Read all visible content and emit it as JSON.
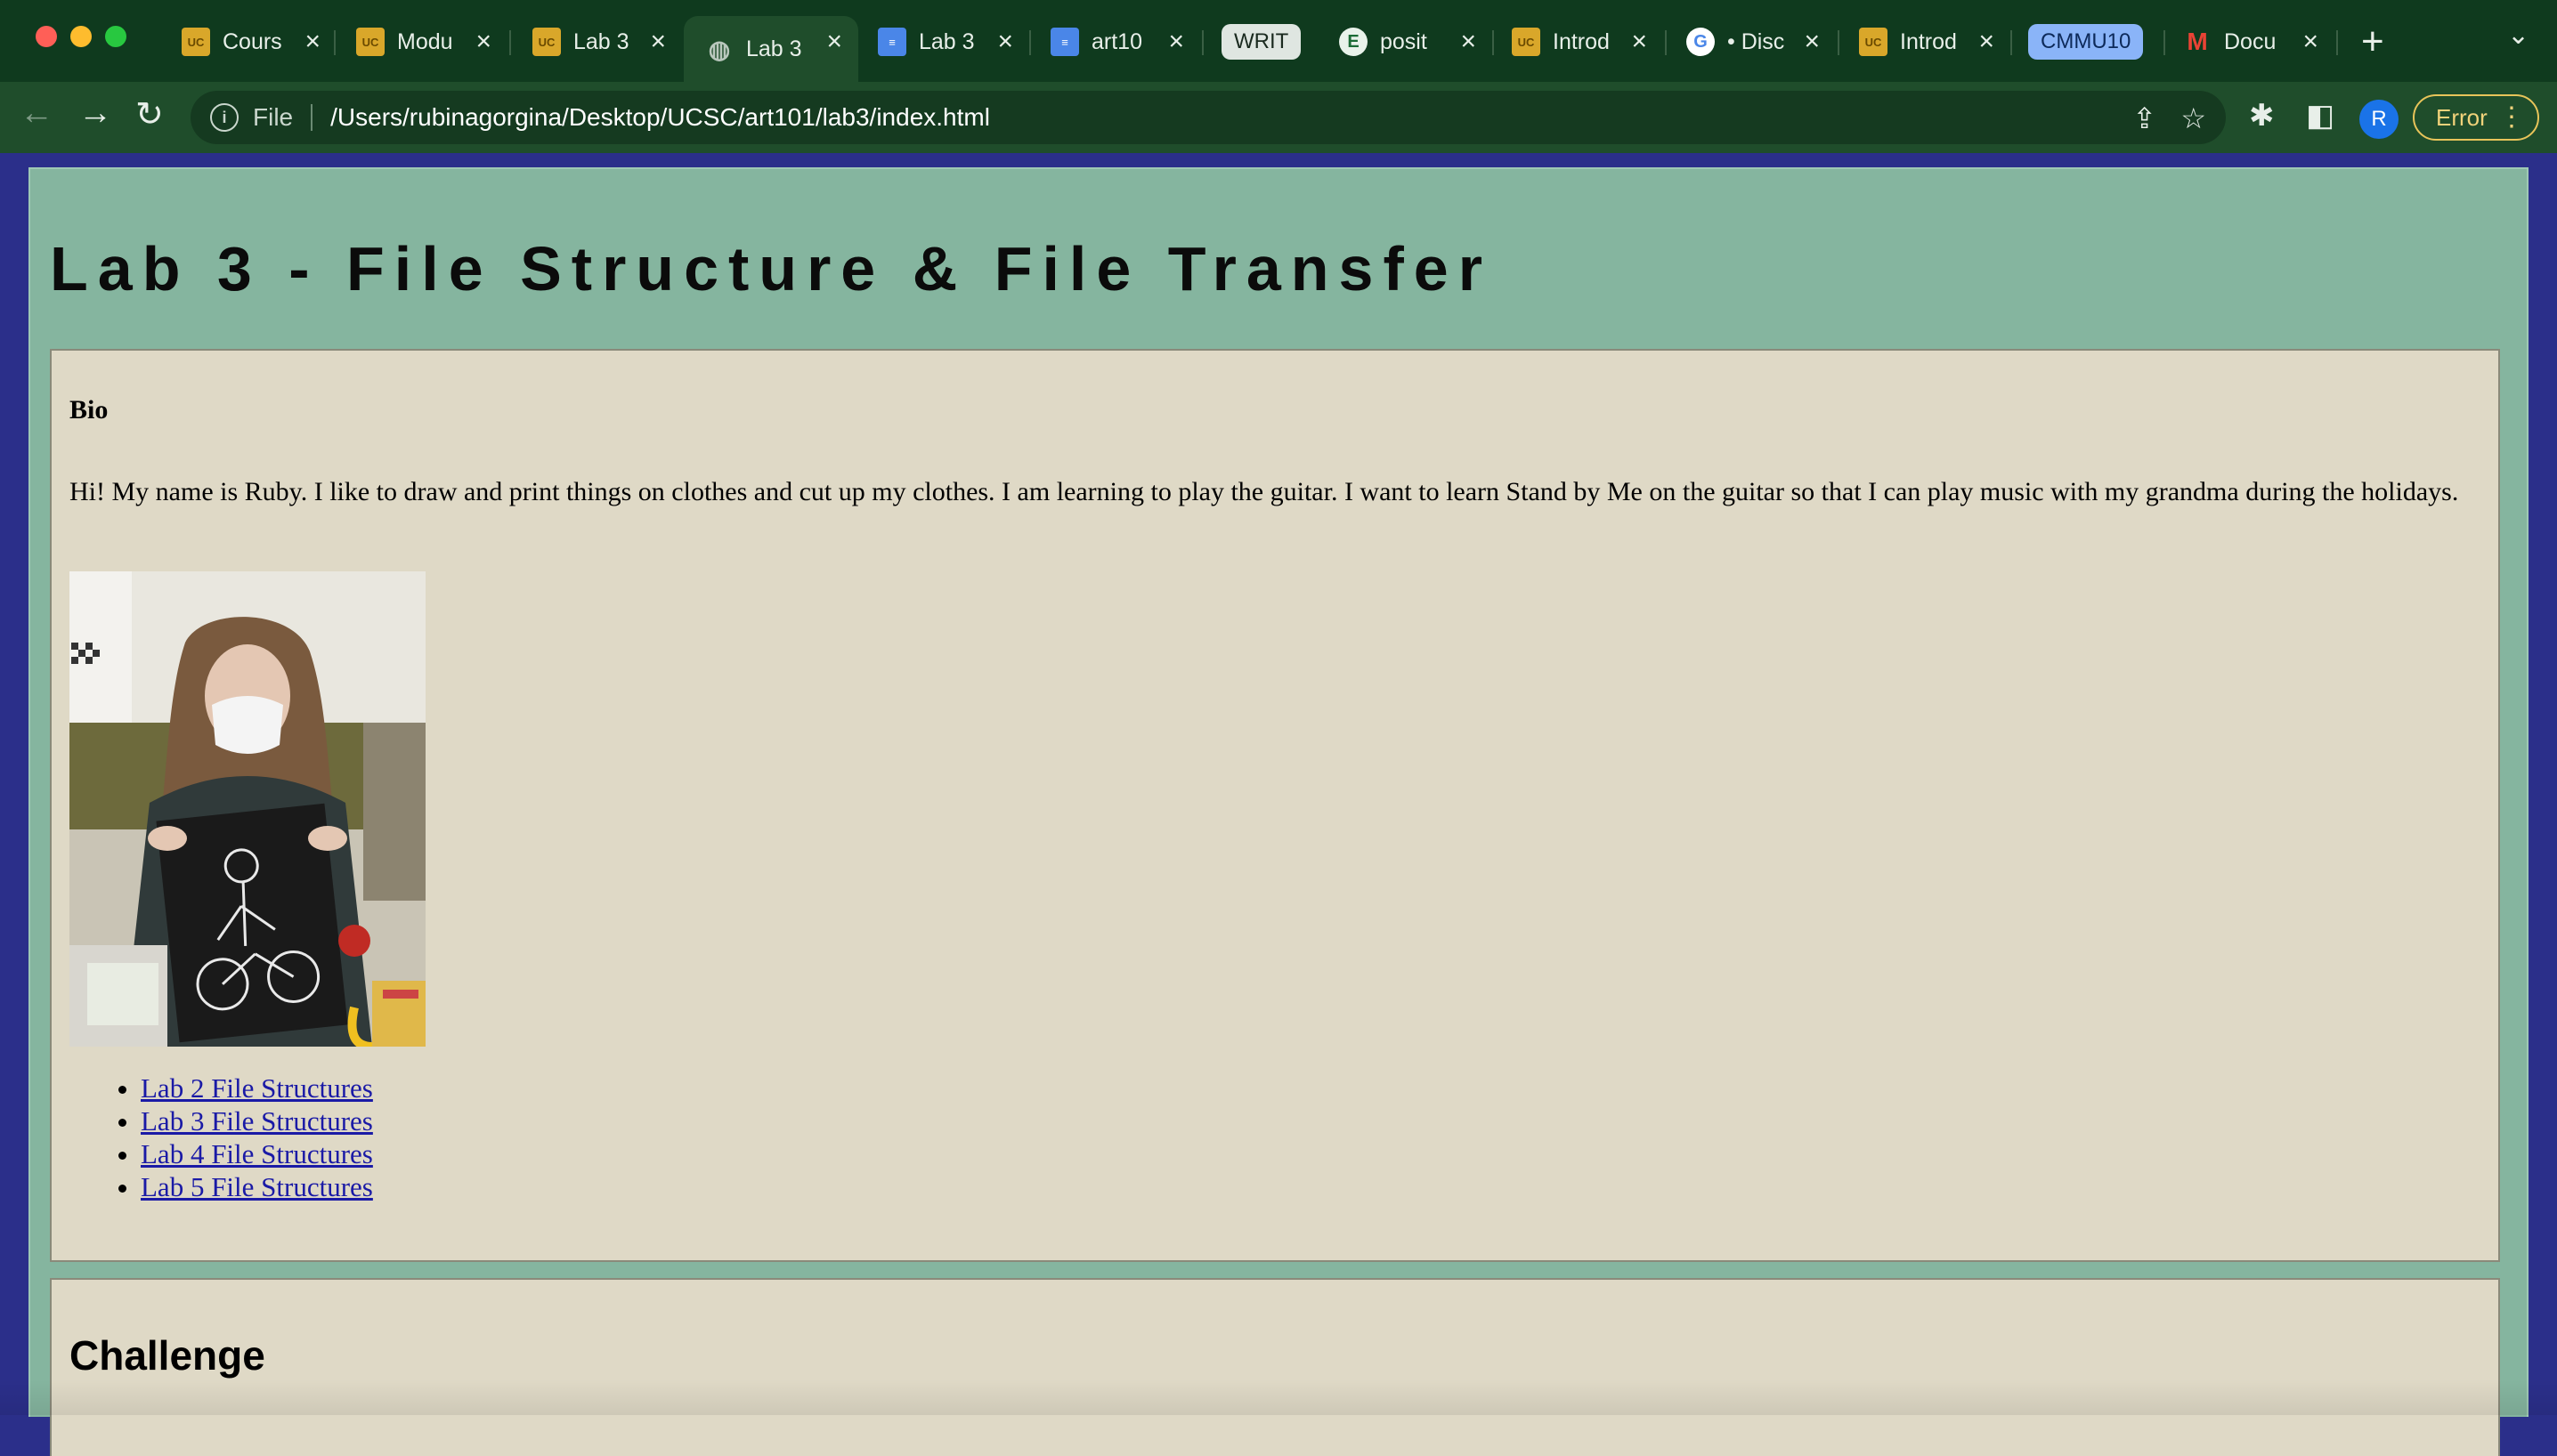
{
  "browser": {
    "tabs": [
      {
        "title": "Cours",
        "favicon": "ucsc-icon",
        "active": false
      },
      {
        "title": "Modu",
        "favicon": "ucsc-icon",
        "active": false
      },
      {
        "title": "Lab 3",
        "favicon": "ucsc-icon",
        "active": false
      },
      {
        "title": "Lab 3",
        "favicon": "globe-icon",
        "active": true
      },
      {
        "title": "Lab 3",
        "favicon": "docs-icon",
        "active": false
      },
      {
        "title": "art10",
        "favicon": "docs-icon",
        "active": false
      },
      {
        "title": "WRIT",
        "favicon": "none",
        "active": false
      },
      {
        "title": "posit",
        "favicon": "e-icon",
        "active": false
      },
      {
        "title": "Introd",
        "favicon": "ucsc-icon",
        "active": false
      },
      {
        "title": "• Disc",
        "favicon": "google-icon",
        "active": false
      },
      {
        "title": "Introd",
        "favicon": "ucsc-icon",
        "active": false
      },
      {
        "title": "CMMU10",
        "favicon": "none",
        "active": false
      },
      {
        "title": "Docu",
        "favicon": "gmail-icon",
        "active": false
      }
    ],
    "address": {
      "scheme_label": "File",
      "url": "/Users/rubinagorgina/Desktop/UCSC/art101/lab3/index.html"
    },
    "profile_initial": "R",
    "error_label": "Error",
    "colors": {
      "tabstrip": "#0f3a1e",
      "toolbar": "#1f4d2b",
      "error_accent": "#e8c45a"
    }
  },
  "page": {
    "title": "Lab 3 - File Structure & File Transfer",
    "bio": {
      "heading": "Bio",
      "text": "Hi! My name is Ruby. I like to draw and print things on clothes and cut up my clothes. I am learning to play the guitar. I want to learn Stand by Me on the guitar so that I can play music with my grandma during the holidays.",
      "links": [
        "Lab 2 File Structures",
        "Lab 3 File Structures",
        "Lab 4 File Structures",
        "Lab 5 File Structures"
      ]
    },
    "challenge": {
      "heading": "Challenge"
    },
    "colors": {
      "outer_background": "#2b2f8a",
      "page_background": "#85b59f",
      "card_background": "#dfd9c6",
      "link": "#1a1aa6"
    }
  }
}
